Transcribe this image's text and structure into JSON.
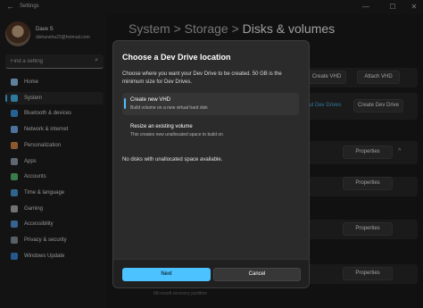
{
  "window": {
    "title": "Settings",
    "back_glyph": "←",
    "minimize_glyph": "—",
    "maximize_glyph": "☐",
    "close_glyph": "✕"
  },
  "user": {
    "name": "Dave S",
    "email": "dishaneha23@hotmail.com"
  },
  "search": {
    "placeholder": "Find a setting",
    "icon": "search-icon"
  },
  "sidebar": {
    "items": [
      {
        "label": "Home",
        "icon": "home-icon",
        "color": "#9ad0ff"
      },
      {
        "label": "System",
        "icon": "system-icon",
        "color": "#4cc2ff",
        "active": true
      },
      {
        "label": "Bluetooth & devices",
        "icon": "bluetooth-icon",
        "color": "#3ea1f0"
      },
      {
        "label": "Network & internet",
        "icon": "network-icon",
        "color": "#7fb8ff"
      },
      {
        "label": "Personalization",
        "icon": "brush-icon",
        "color": "#e0904a"
      },
      {
        "label": "Apps",
        "icon": "apps-icon",
        "color": "#9aa7ba"
      },
      {
        "label": "Accounts",
        "icon": "accounts-icon",
        "color": "#5ec77a"
      },
      {
        "label": "Time & language",
        "icon": "clock-icon",
        "color": "#4aa3e0"
      },
      {
        "label": "Gaming",
        "icon": "gaming-icon",
        "color": "#b9b9b9"
      },
      {
        "label": "Accessibility",
        "icon": "accessibility-icon",
        "color": "#5aa0e6"
      },
      {
        "label": "Privacy & security",
        "icon": "shield-icon",
        "color": "#8f9aa8"
      },
      {
        "label": "Windows Update",
        "icon": "update-icon",
        "color": "#3f8fe0"
      }
    ]
  },
  "breadcrumb": {
    "part1": "System",
    "sep1": ">",
    "part2": "Storage",
    "sep2": ">",
    "part3": "Disks & volumes"
  },
  "main": {
    "create_vhd": "Create VHD",
    "attach_vhd": "Attach VHD",
    "dev_drives_link": "out Dev Drives",
    "create_dev_drive": "Create Dev Drive",
    "properties": "Properties",
    "recovery_partition": "Microsoft recovery partition",
    "chevron": "^"
  },
  "dialog": {
    "title": "Choose a Dev Drive location",
    "description": "Choose where you want your Dev Drive to be created. 50 GB is the minimum size for Dev Drives.",
    "options": [
      {
        "title": "Create new VHD",
        "subtitle": "Build volume on a new virtual hard disk",
        "selected": true
      },
      {
        "title": "Resize an existing volume",
        "subtitle": "This creates new unallocated space to build on",
        "selected": false
      }
    ],
    "message": "No disks with unallocated space available.",
    "next_label": "Next",
    "cancel_label": "Cancel"
  }
}
